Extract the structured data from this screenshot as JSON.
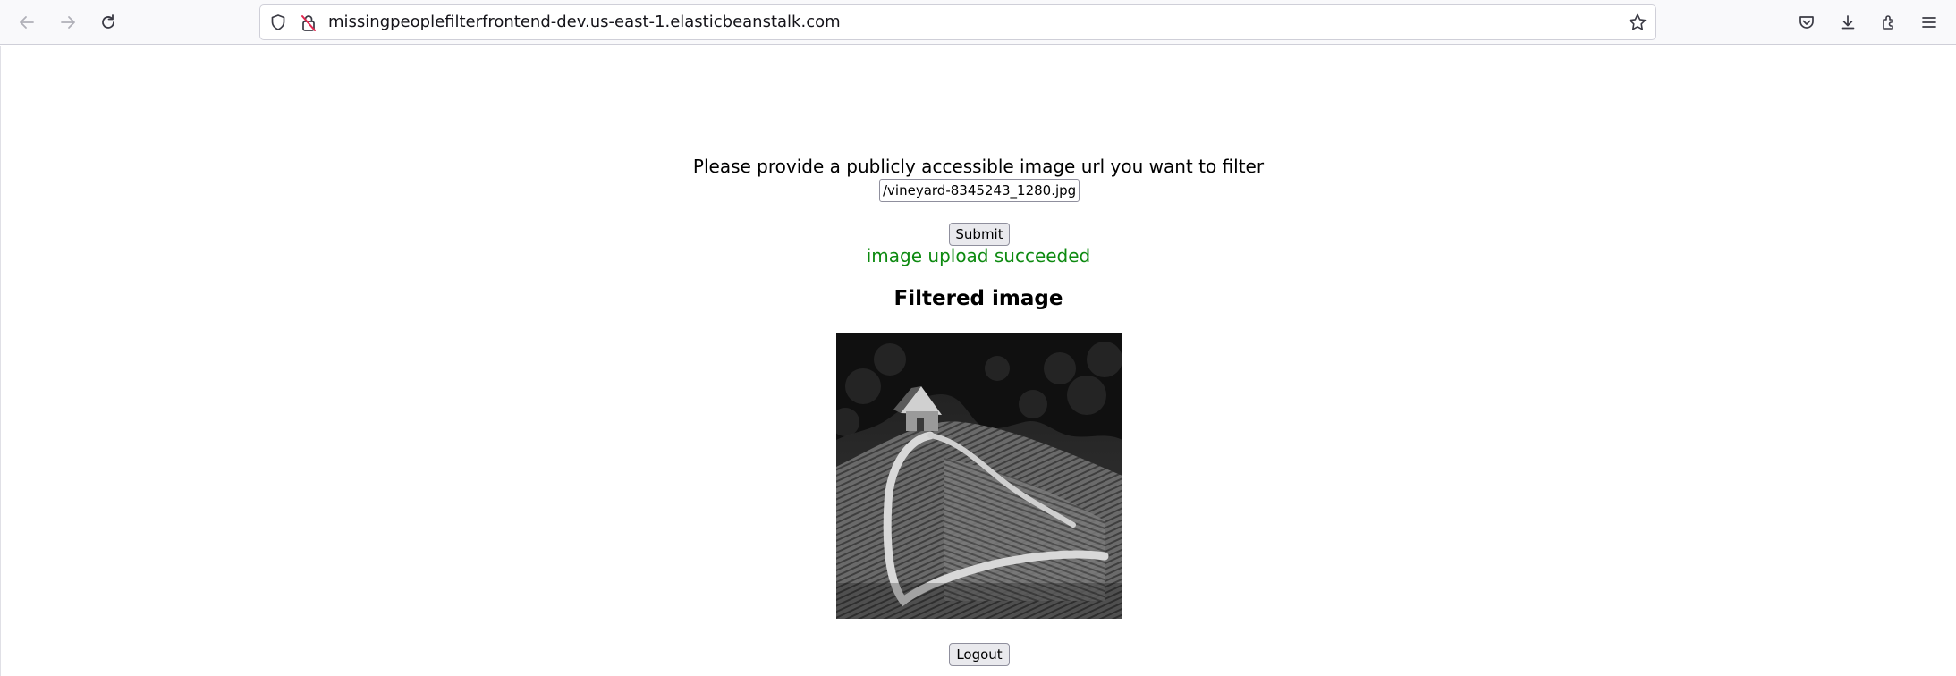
{
  "browser": {
    "url": "missingpeoplefilterfrontend-dev.us-east-1.elasticbeanstalk.com",
    "icons": {
      "back": "back-arrow-icon",
      "forward": "forward-arrow-icon",
      "reload": "reload-icon",
      "tracking_protection": "shield-icon",
      "connection": "insecure-lock-icon",
      "bookmark": "star-icon",
      "pocket": "pocket-icon",
      "downloads": "download-icon",
      "extensions": "extensions-icon",
      "menu": "hamburger-menu-icon"
    }
  },
  "form": {
    "prompt": "Please provide a publicly accessible image url you want to filter",
    "url_value": "/vineyard-8345243_1280.jpg",
    "submit_label": "Submit",
    "status_message": "image upload succeeded",
    "status_color": "#0d8a10"
  },
  "result": {
    "heading": "Filtered image",
    "image_description": "grayscale vineyard with heart-shaped road and house"
  },
  "footer": {
    "logout_label": "Logout"
  }
}
